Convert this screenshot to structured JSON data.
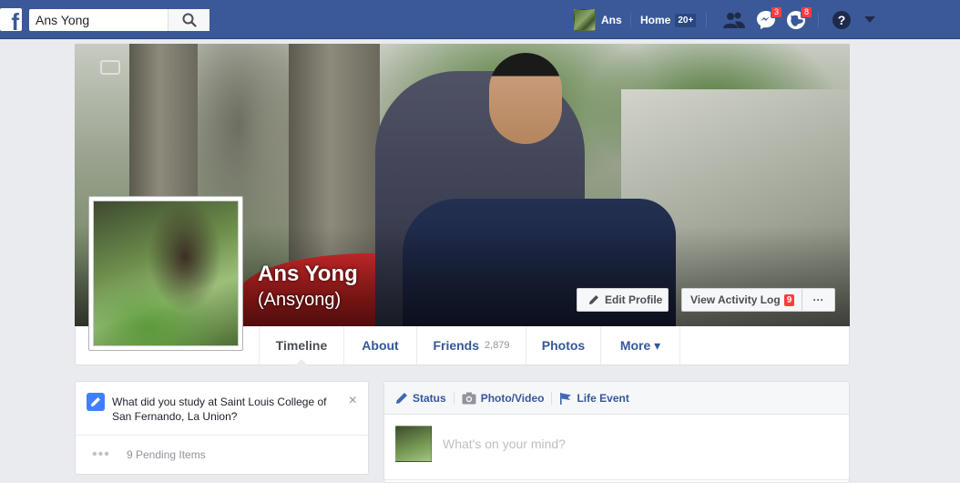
{
  "topbar": {
    "logo_letter": "f",
    "search_value": "Ans Yong",
    "user_name": "Ans",
    "home_label": "Home",
    "home_count": "20+",
    "messages_count": "3",
    "notifications_count": "8"
  },
  "profile": {
    "name": "Ans Yong",
    "alternate_name": "(Ansyong)",
    "edit_profile_label": "Edit Profile",
    "activity_log_label": "View Activity Log",
    "activity_log_count": "9",
    "more_label": "···"
  },
  "tabs": [
    {
      "label": "Timeline",
      "count": ""
    },
    {
      "label": "About",
      "count": ""
    },
    {
      "label": "Friends",
      "count": "2,879"
    },
    {
      "label": "Photos",
      "count": ""
    },
    {
      "label": "More ▾",
      "count": ""
    }
  ],
  "left_card": {
    "education_prompt": "What did you study at Saint Louis College of San Fernando, La Union?",
    "close": "×",
    "pending_dots": "•••",
    "pending_items": "9 Pending Items"
  },
  "composer": {
    "status_label": "Status",
    "photo_label": "Photo/Video",
    "life_event_label": "Life Event",
    "placeholder": "What's on your mind?"
  },
  "colors": {
    "brand": "#3b5998",
    "badge": "#fa3e3e",
    "link": "#365899"
  }
}
